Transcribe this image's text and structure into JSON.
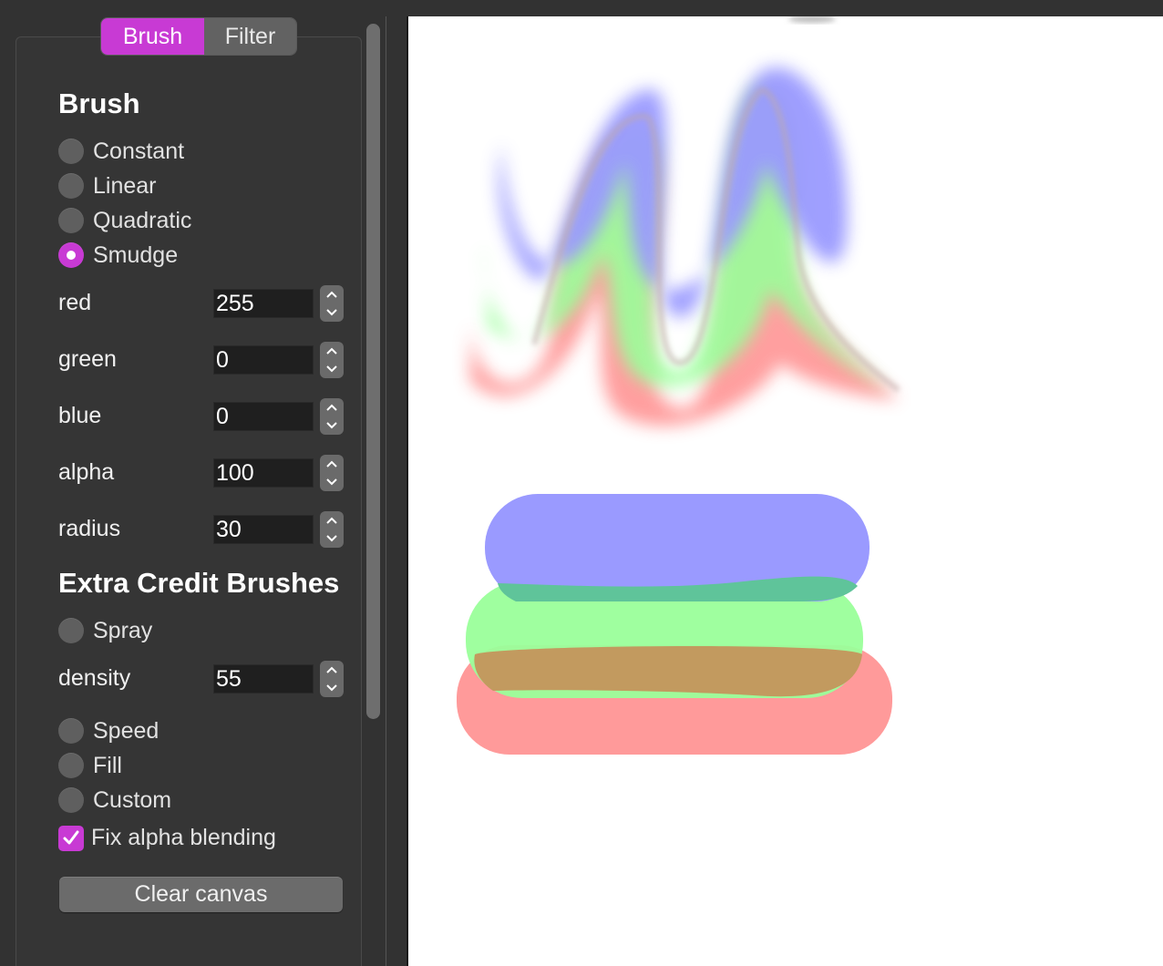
{
  "tabs": [
    {
      "label": "Brush",
      "active": true
    },
    {
      "label": "Filter",
      "active": false
    }
  ],
  "brush_section": {
    "title": "Brush",
    "modes": [
      {
        "label": "Constant",
        "selected": false
      },
      {
        "label": "Linear",
        "selected": false
      },
      {
        "label": "Quadratic",
        "selected": false
      },
      {
        "label": "Smudge",
        "selected": true
      }
    ],
    "fields": [
      {
        "label": "red",
        "value": "255"
      },
      {
        "label": "green",
        "value": "0"
      },
      {
        "label": "blue",
        "value": "0"
      },
      {
        "label": "alpha",
        "value": "100"
      },
      {
        "label": "radius",
        "value": "30"
      }
    ]
  },
  "extra_section": {
    "title": "Extra Credit Brushes",
    "spray": {
      "label": "Spray",
      "selected": false
    },
    "density": {
      "label": "density",
      "value": "55"
    },
    "modes": [
      {
        "label": "Speed",
        "selected": false
      },
      {
        "label": "Fill",
        "selected": false
      },
      {
        "label": "Custom",
        "selected": false
      }
    ],
    "fix_alpha": {
      "label": "Fix alpha blending",
      "checked": true
    }
  },
  "clear_button": {
    "label": "Clear canvas"
  },
  "colors": {
    "accent": "#c83ad4",
    "panel_bg": "#353535",
    "canvas_bg": "#ffffff",
    "stroke_blue": "#9a9aff",
    "stroke_green": "#9aff9a",
    "stroke_red": "#ff9a9a"
  }
}
